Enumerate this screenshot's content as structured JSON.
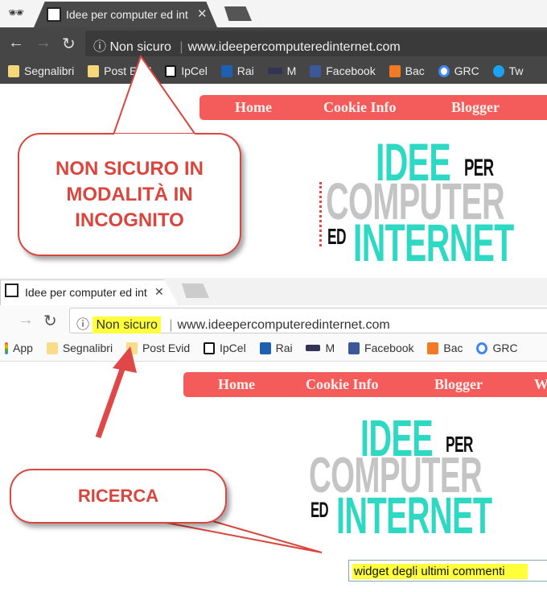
{
  "window1": {
    "tab_title": "Idee per computer ed int",
    "security": "Non sicuro",
    "url": "www.ideepercomputeredinternet.com",
    "bookmarks": [
      "Segnalibri",
      "Post Evid",
      "IpCel",
      "Rai",
      "M",
      "Facebook",
      "Bac",
      "GRC",
      "Tw"
    ]
  },
  "window2": {
    "tab_title": "Idee per computer ed int",
    "security": "Non sicuro",
    "url": "www.ideepercomputeredinternet.com",
    "bookmarks": [
      "App",
      "Segnalibri",
      "Post Evid",
      "IpCel",
      "Rai",
      "M",
      "Facebook",
      "Bac",
      "GRC"
    ]
  },
  "nav1": [
    "Home",
    "Cookie Info",
    "Blogger"
  ],
  "nav2": [
    "Home",
    "Cookie Info",
    "Blogger",
    "W"
  ],
  "logo": {
    "line1": "IDEE",
    "per": "PER",
    "line2": "COMPUTER",
    "ed": "ED",
    "line3": "INTERNET"
  },
  "callout1": "NON SICURO IN MODALITÀ IN INCOGNITO",
  "callout2": "RICERCA",
  "search_value": "widget degli ultimi commenti",
  "colors": {
    "accent": "#f45b5b",
    "callout": "#d9463e",
    "logo_teal": "#2ed9c3",
    "logo_gray": "#c4c4c4",
    "highlight": "#ffff3a"
  }
}
